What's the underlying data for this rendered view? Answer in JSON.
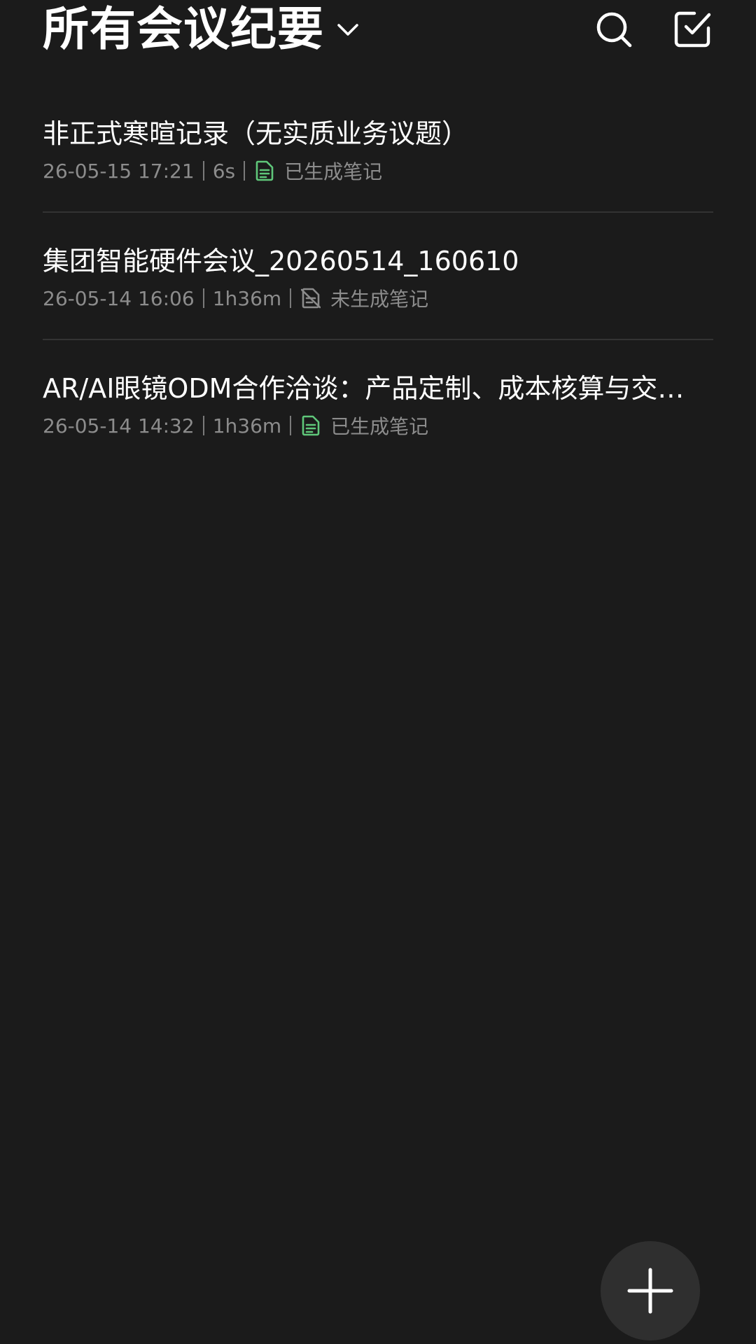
{
  "header": {
    "title": "所有会议纪要",
    "title_dropdown_icon": "chevron-down-icon",
    "search_icon": "search-icon",
    "select_icon": "checkbox-edit-icon"
  },
  "meetings": [
    {
      "title": "非正式寒暄记录（无实质业务议题）",
      "datetime": "26-05-15 17:21",
      "duration": "6s",
      "note_status": "已生成笔记",
      "note_generated": true
    },
    {
      "title": "集团智能硬件会议_20260514_160610",
      "datetime": "26-05-14 16:06",
      "duration": "1h36m",
      "note_status": "未生成笔记",
      "note_generated": false
    },
    {
      "title": "AR/AI眼镜ODM合作洽谈：产品定制、成本核算与交…",
      "datetime": "26-05-14 14:32",
      "duration": "1h36m",
      "note_status": "已生成笔记",
      "note_generated": true
    }
  ],
  "fab": {
    "icon": "plus-icon"
  },
  "colors": {
    "background": "#1b1b1b",
    "title_text": "#ffffff",
    "meta_text": "#8c8c8c",
    "note_generated_icon": "#5fc77a",
    "note_missing_icon": "#8c8c8c",
    "divider": "#333333",
    "fab_background": "#2f2f2f"
  }
}
